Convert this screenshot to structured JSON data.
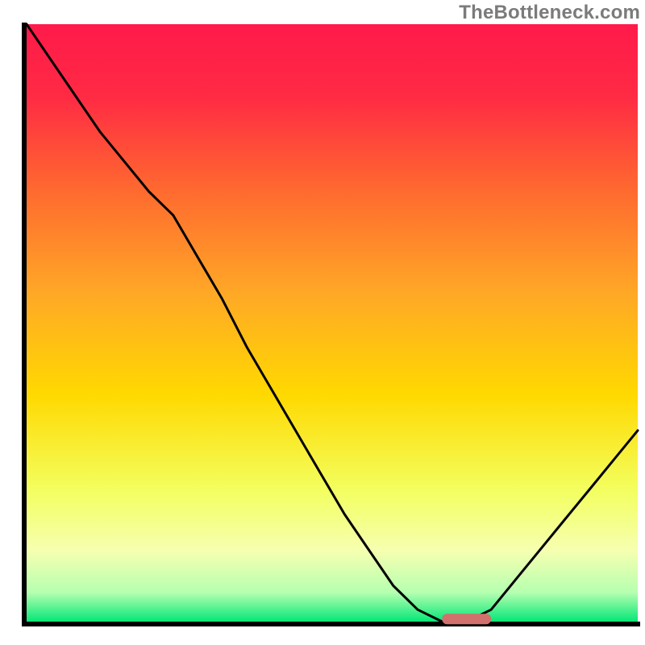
{
  "watermark": "TheBottleneck.com",
  "colors": {
    "gradient_top": "#ff1a4a",
    "gradient_mid": "#ffd900",
    "gradient_low": "#f6ffb0",
    "gradient_bottom": "#00e676",
    "curve": "#000000",
    "marker": "#d2706e",
    "frame": "#000000"
  },
  "chart_data": {
    "type": "line",
    "title": "",
    "subtitle": "",
    "xlabel": "",
    "ylabel": "",
    "xlim": [
      0,
      100
    ],
    "ylim": [
      0,
      100
    ],
    "grid": false,
    "legend": false,
    "annotations": [],
    "series": [
      {
        "name": "bottleneck-curve",
        "x": [
          0,
          4,
          8,
          12,
          16,
          20,
          24,
          28,
          32,
          36,
          40,
          44,
          48,
          52,
          56,
          60,
          64,
          68,
          72,
          76,
          80,
          84,
          88,
          92,
          96,
          100
        ],
        "y": [
          100,
          94,
          88,
          82,
          77,
          72,
          68,
          61,
          54,
          46,
          39,
          32,
          25,
          18,
          12,
          6,
          2,
          0,
          0,
          2,
          7,
          12,
          17,
          22,
          27,
          32
        ]
      }
    ],
    "marker": {
      "x_start": 68,
      "x_end": 76,
      "y": 0.5
    },
    "notes": "y estimated as percentage of plot-area height above baseline; curve starts at top-left, dips to ~0 around x≈68–76, rises toward right."
  }
}
